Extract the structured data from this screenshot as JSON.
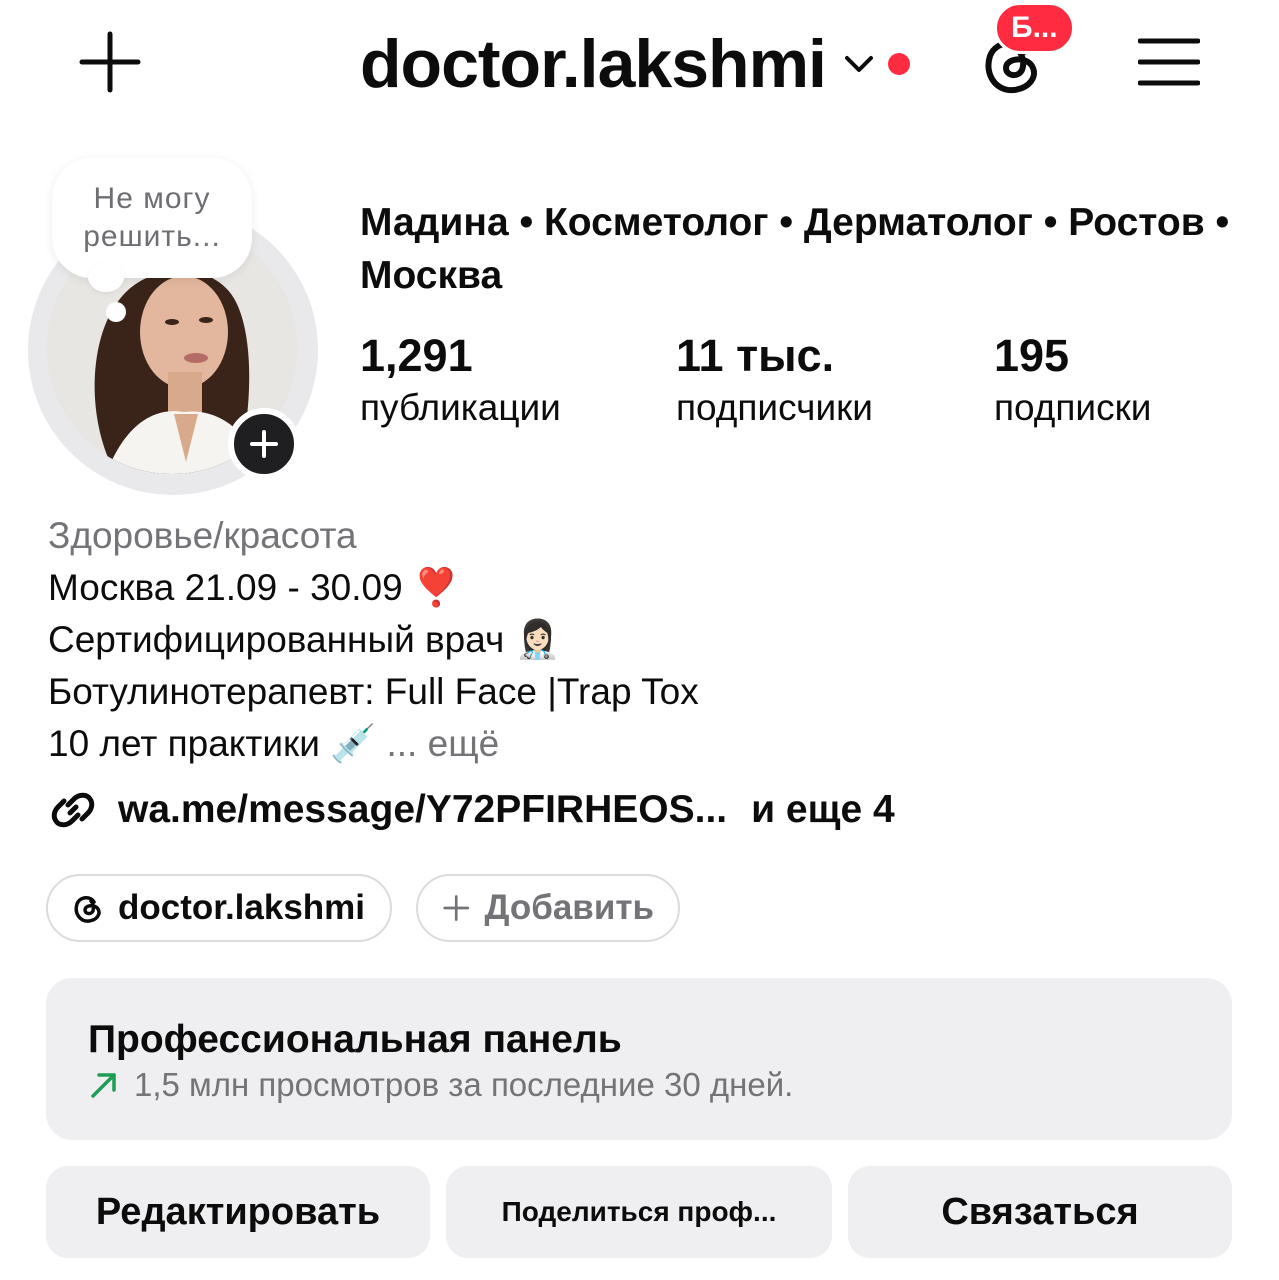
{
  "header": {
    "username": "doctor.lakshmi",
    "threads_badge": "Б...",
    "icons": {
      "create": "plus-icon",
      "account_switch": "chevron-down-icon",
      "notification": "red-dot",
      "threads": "threads-icon",
      "menu": "hamburger-menu-icon"
    }
  },
  "profile": {
    "note": "Не могу решить...",
    "full_name": "Мадина • Косметолог • Дерматолог • Ростов • Москва",
    "stats": [
      {
        "value": "1,291",
        "label": "публикации"
      },
      {
        "value": "11 тыс.",
        "label": "подписчики"
      },
      {
        "value": "195",
        "label": "подписки"
      }
    ]
  },
  "bio": {
    "category": "Здоровье/красота",
    "lines": [
      "Москва 21.09 - 30.09 ❣️",
      "Сертифицированный врач 👩🏻‍⚕️",
      "Ботулинотерапевт: Full Face |Trap Tox"
    ],
    "last_line": "10 лет практики 💉",
    "more": "... ещё",
    "link": "wa.me/message/Y72PFIRHEOS...",
    "link_more": "и еще 4"
  },
  "chips": {
    "threads_label": "doctor.lakshmi",
    "add_label": "Добавить"
  },
  "dashboard": {
    "title": "Профессиональная панель",
    "subtitle": "1,5 млн просмотров за последние 30 дней.",
    "accent": "#1f9d55"
  },
  "actions": {
    "edit": "Редактировать",
    "share": "Поделиться проф...",
    "contact": "Связаться"
  },
  "colors": {
    "badge_red": "#ff2b40",
    "secondary_text": "#737378",
    "panel_bg": "#efeff2"
  }
}
